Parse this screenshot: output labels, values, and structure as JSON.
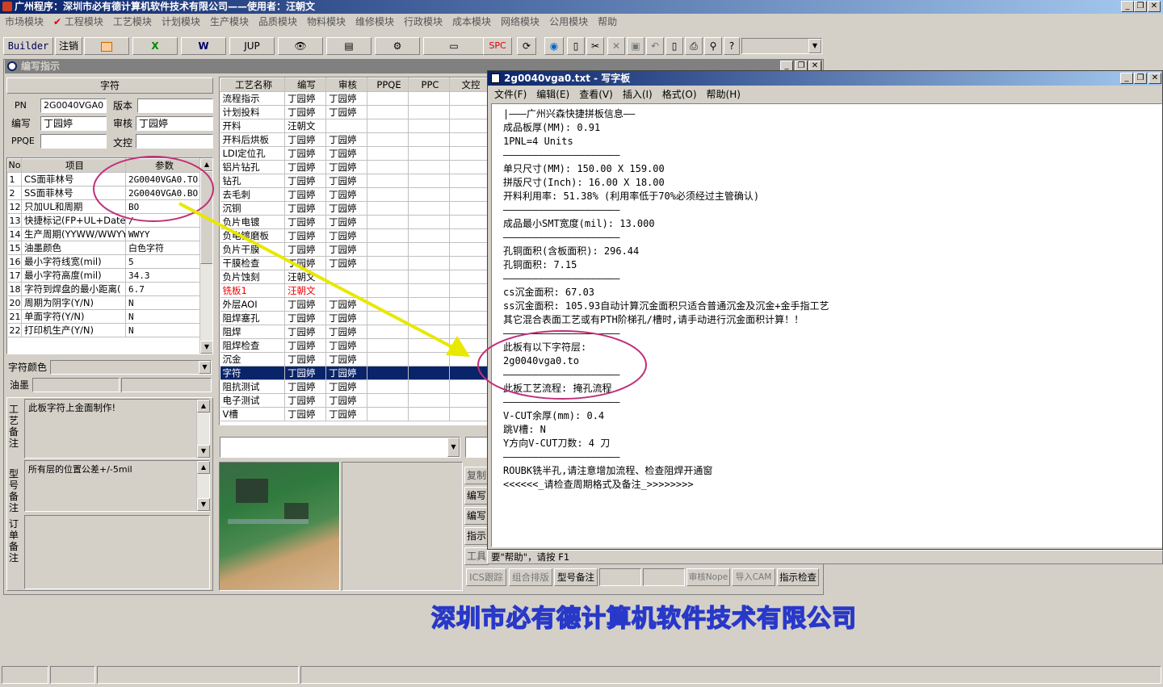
{
  "app": {
    "title": "广州程序：深圳市必有德计算机软件技术有限公司——使用者：汪朝文"
  },
  "menu": [
    "市场模块",
    "工程模块",
    "工艺模块",
    "计划模块",
    "生产模块",
    "品质模块",
    "物料模块",
    "维修模块",
    "行政模块",
    "成本模块",
    "网络模块",
    "公用模块",
    "帮助"
  ],
  "toolbar": {
    "builder": "Builder",
    "logout": "注销",
    "jup": "JUP",
    "spc": "SPC"
  },
  "child": {
    "title": "编写指示"
  },
  "form": {
    "section_label": "字符",
    "pn_label": "PN",
    "pn_value": "2G0040VGA0",
    "version_label": "版本",
    "version_value": "",
    "writer_label": "编写",
    "writer_value": "丁园婷",
    "review_label": "审核",
    "review_value": "丁园婷",
    "ppqe_label": "PPQE",
    "ppqe_value": "",
    "doc_label": "文控",
    "doc_value": ""
  },
  "params": {
    "headers": [
      "No",
      "项目",
      "参数"
    ],
    "rows": [
      {
        "no": "1",
        "item": "CS面菲林号",
        "value": "2G0040VGA0.TO"
      },
      {
        "no": "2",
        "item": "SS面菲林号",
        "value": "2G0040VGA0.BO"
      },
      {
        "no": "12",
        "item": "只加UL和周期",
        "value": "BO"
      },
      {
        "no": "13",
        "item": "快捷标记(FP+UL+DateCo",
        "value": "/"
      },
      {
        "no": "14",
        "item": "生产周期(YYWW/WWYY)",
        "value": "WWYY"
      },
      {
        "no": "15",
        "item": "油墨颜色",
        "value": "白色字符"
      },
      {
        "no": "16",
        "item": "最小字符线宽(mil)",
        "value": "5"
      },
      {
        "no": "17",
        "item": "最小字符高度(mil)",
        "value": "34.3"
      },
      {
        "no": "18",
        "item": "字符到焊盘的最小距离(",
        "value": "6.7"
      },
      {
        "no": "20",
        "item": "周期为阴字(Y/N)",
        "value": "N"
      },
      {
        "no": "21",
        "item": "单面字符(Y/N)",
        "value": "N"
      },
      {
        "no": "22",
        "item": "打印机生产(Y/N)",
        "value": "N"
      }
    ]
  },
  "char_color_label": "字符颜色",
  "ink_label": "油墨",
  "notes": {
    "process_label": "工艺备注",
    "process_text": "此板字符上金面制作!",
    "model_label": "型号备注",
    "model_text": "所有层的位置公差+/-5mil",
    "order_label": "订单备注",
    "order_text": ""
  },
  "process": {
    "headers": [
      "工艺名称",
      "编写",
      "审核",
      "PPQE",
      "PPC",
      "文控"
    ],
    "rows": [
      {
        "name": "流程指示",
        "writer": "丁园婷",
        "review": "丁园婷"
      },
      {
        "name": "计划投料",
        "writer": "丁园婷",
        "review": "丁园婷"
      },
      {
        "name": "开料",
        "writer": "汪朝文",
        "review": ""
      },
      {
        "name": "开料后烘板",
        "writer": "丁园婷",
        "review": "丁园婷"
      },
      {
        "name": "LDI定位孔",
        "writer": "丁园婷",
        "review": "丁园婷"
      },
      {
        "name": "铝片钻孔",
        "writer": "丁园婷",
        "review": "丁园婷"
      },
      {
        "name": "钻孔",
        "writer": "丁园婷",
        "review": "丁园婷"
      },
      {
        "name": "去毛刺",
        "writer": "丁园婷",
        "review": "丁园婷"
      },
      {
        "name": "沉铜",
        "writer": "丁园婷",
        "review": "丁园婷"
      },
      {
        "name": "负片电镀",
        "writer": "丁园婷",
        "review": "丁园婷"
      },
      {
        "name": "负电镀磨板",
        "writer": "丁园婷",
        "review": "丁园婷"
      },
      {
        "name": "负片干膜",
        "writer": "丁园婷",
        "review": "丁园婷"
      },
      {
        "name": "干膜检查",
        "writer": "丁园婷",
        "review": "丁园婷"
      },
      {
        "name": "负片蚀刻",
        "writer": "汪朝文",
        "review": ""
      },
      {
        "name": "铣板1",
        "writer": "汪朝文",
        "review": ""
      },
      {
        "name": "外层AOI",
        "writer": "丁园婷",
        "review": "丁园婷"
      },
      {
        "name": "阻焊塞孔",
        "writer": "丁园婷",
        "review": "丁园婷"
      },
      {
        "name": "阻焊",
        "writer": "丁园婷",
        "review": "丁园婷"
      },
      {
        "name": "阻焊检查",
        "writer": "丁园婷",
        "review": "丁园婷"
      },
      {
        "name": "沉金",
        "writer": "丁园婷",
        "review": "丁园婷"
      },
      {
        "name": "字符",
        "writer": "丁园婷",
        "review": "丁园婷"
      },
      {
        "name": "阻抗测试",
        "writer": "丁园婷",
        "review": "丁园婷"
      },
      {
        "name": "电子测试",
        "writer": "丁园婷",
        "review": "丁园婷"
      },
      {
        "name": "V槽",
        "writer": "丁园婷",
        "review": "丁园婷"
      }
    ]
  },
  "side_buttons": [
    "复制",
    "编写",
    "编写",
    "指示",
    "工具"
  ],
  "bottom_buttons": [
    "ICS跟踪",
    "组合排版",
    "型号备注",
    "审核Nope",
    "导入CAM",
    "指示检查"
  ],
  "notepad": {
    "title": "2g0040vga0.txt - 写字板",
    "menu": [
      "文件(F)",
      "编辑(E)",
      "查看(V)",
      "插入(I)",
      "格式(O)",
      "帮助(H)"
    ],
    "lines": [
      "|———广州兴森快捷拼板信息——",
      "成品板厚(MM): 0.91",
      "1PNL=4 Units",
      "————————————————————",
      "单只尺寸(MM): 150.00 X 159.00",
      "拼版尺寸(Inch): 16.00 X 18.00",
      "开料利用率: 51.38% (利用率低于70%必须经过主管确认)",
      "————————————————————",
      "成品最小SMT宽度(mil): 13.000",
      "————————————————————",
      "孔铜面积(含板面积): 296.44",
      "孔铜面积: 7.15",
      "————————————————————",
      "cs沉金面积: 67.03",
      "ss沉金面积: 105.93自动计算沉金面积只适合普通沉金及沉金+金手指工艺",
      "其它混合表面工艺或有PTH阶梯孔/槽时,请手动进行沉金面积计算！！",
      "————————————————————",
      "此板有以下字符层:",
      "2g0040vga0.to",
      "————————————————————",
      "此板工艺流程: 掩孔流程",
      "————————————————————",
      "V-CUT余厚(mm): 0.4",
      "跳V槽: N",
      "Y方向V-CUT刀数: 4 刀",
      "————————————————————",
      "ROUBK铣半孔,请注意增加流程、检查阻焊开通窗",
      "<<<<<<_请检查周期格式及备注_>>>>>>>>"
    ],
    "status": "要\"帮助\"，请按 F1"
  },
  "company_name": "深圳市必有德计算机软件技术有限公司",
  "colors": {
    "title_active": "#0a246a",
    "selection": "#0a246a",
    "highlight_circle": "#c0307a",
    "arrow": "#e8e800"
  }
}
